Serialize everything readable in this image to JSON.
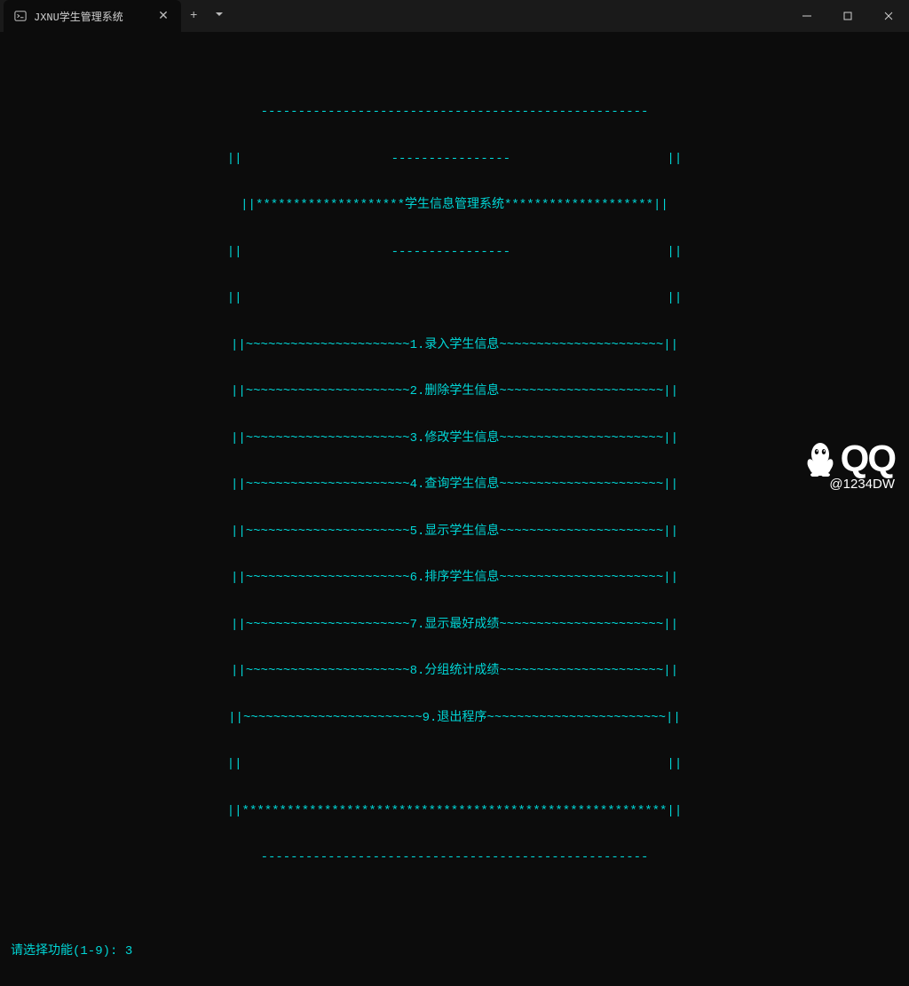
{
  "titlebar": {
    "tab_title": "JXNU学生管理系统"
  },
  "menu": {
    "top_rule": "----------------------------------------------------",
    "header_mid": "||                    ----------------                     ||",
    "header": "||********************学生信息管理系统********************||",
    "header_bot": "||                    ----------------                     ||",
    "items": [
      "||~~~~~~~~~~~~~~~~~~~~~~1.录入学生信息~~~~~~~~~~~~~~~~~~~~~~||",
      "||~~~~~~~~~~~~~~~~~~~~~~2.删除学生信息~~~~~~~~~~~~~~~~~~~~~~||",
      "||~~~~~~~~~~~~~~~~~~~~~~3.修改学生信息~~~~~~~~~~~~~~~~~~~~~~||",
      "||~~~~~~~~~~~~~~~~~~~~~~4.查询学生信息~~~~~~~~~~~~~~~~~~~~~~||",
      "||~~~~~~~~~~~~~~~~~~~~~~5.显示学生信息~~~~~~~~~~~~~~~~~~~~~~||",
      "||~~~~~~~~~~~~~~~~~~~~~~6.排序学生信息~~~~~~~~~~~~~~~~~~~~~~||",
      "||~~~~~~~~~~~~~~~~~~~~~~7.显示最好成绩~~~~~~~~~~~~~~~~~~~~~~||",
      "||~~~~~~~~~~~~~~~~~~~~~~8.分组统计成绩~~~~~~~~~~~~~~~~~~~~~~||",
      "||~~~~~~~~~~~~~~~~~~~~~~~~9.退出程序~~~~~~~~~~~~~~~~~~~~~~~~||"
    ],
    "blank_row": "||                                                         ||",
    "footer": "||*********************************************************||",
    "bottom_rule": "----------------------------------------------------"
  },
  "prompt": {
    "label": "请选择功能(1-9):",
    "input_value": " 3"
  },
  "watermark": {
    "brand": "QQ",
    "handle": "@1234DW"
  }
}
